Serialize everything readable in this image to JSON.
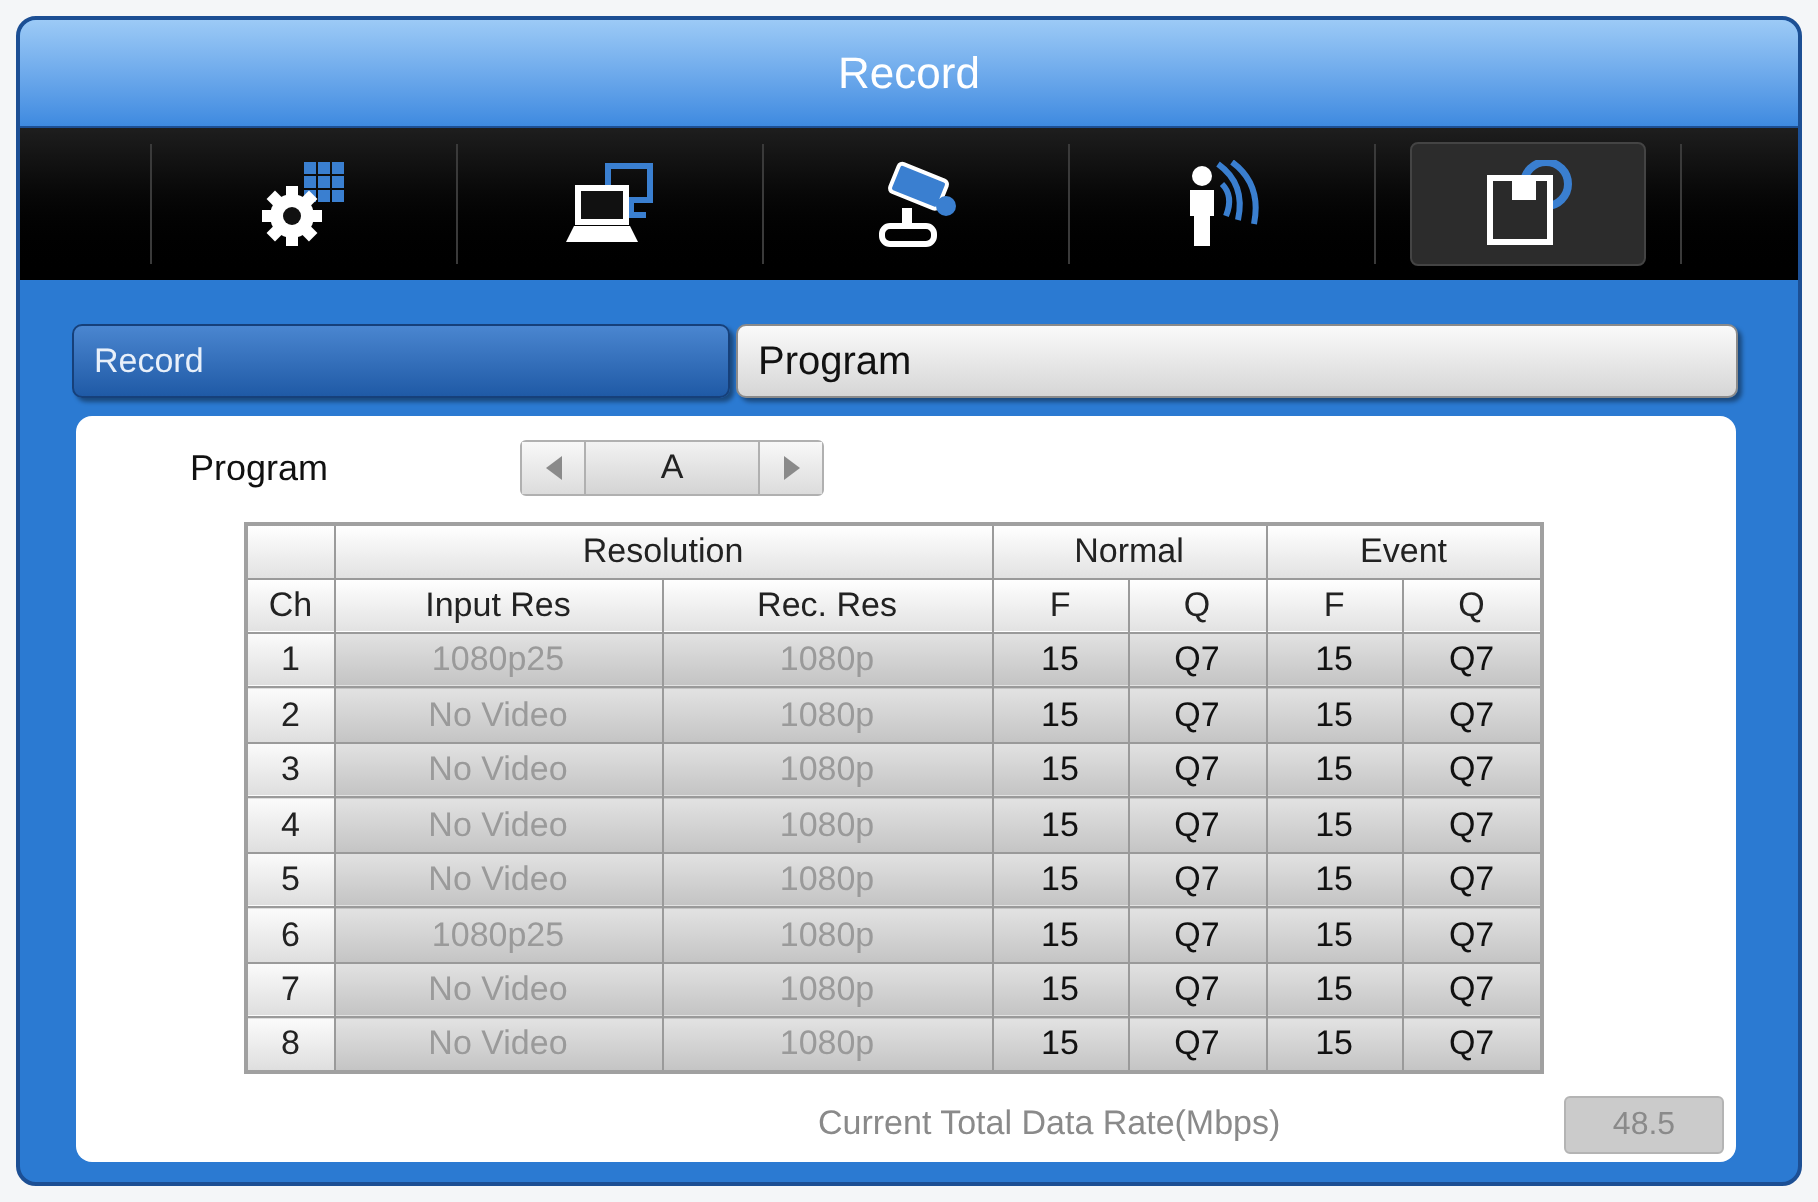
{
  "window": {
    "title": "Record"
  },
  "toolbar": [
    {
      "kind": "setup",
      "selected": false
    },
    {
      "kind": "network",
      "selected": false
    },
    {
      "kind": "camera",
      "selected": false
    },
    {
      "kind": "event",
      "selected": false
    },
    {
      "kind": "record",
      "selected": true
    }
  ],
  "tabs": [
    {
      "label": "Record",
      "selected": true
    },
    {
      "label": "Program",
      "selected": false
    }
  ],
  "program": {
    "label": "Program",
    "value": "A"
  },
  "table": {
    "first_column": "Ch",
    "column_groups": [
      {
        "label": "Resolution",
        "disabled": true,
        "columns": [
          "Input Res",
          "Rec. Res"
        ]
      },
      {
        "label": "Normal",
        "disabled": false,
        "columns": [
          "F",
          "Q"
        ]
      },
      {
        "label": "Event",
        "disabled": false,
        "columns": [
          "F",
          "Q"
        ]
      }
    ],
    "rows": [
      {
        "ch": "1",
        "cells": [
          "1080p25",
          "1080p",
          "15",
          "Q7",
          "15",
          "Q7"
        ]
      },
      {
        "ch": "2",
        "cells": [
          "No Video",
          "1080p",
          "15",
          "Q7",
          "15",
          "Q7"
        ]
      },
      {
        "ch": "3",
        "cells": [
          "No Video",
          "1080p",
          "15",
          "Q7",
          "15",
          "Q7"
        ]
      },
      {
        "ch": "4",
        "cells": [
          "No Video",
          "1080p",
          "15",
          "Q7",
          "15",
          "Q7"
        ]
      },
      {
        "ch": "5",
        "cells": [
          "No Video",
          "1080p",
          "15",
          "Q7",
          "15",
          "Q7"
        ]
      },
      {
        "ch": "6",
        "cells": [
          "1080p25",
          "1080p",
          "15",
          "Q7",
          "15",
          "Q7"
        ]
      },
      {
        "ch": "7",
        "cells": [
          "No Video",
          "1080p",
          "15",
          "Q7",
          "15",
          "Q7"
        ]
      },
      {
        "ch": "8",
        "cells": [
          "No Video",
          "1080p",
          "15",
          "Q7",
          "15",
          "Q7"
        ]
      }
    ]
  },
  "data_rate": {
    "label": "Current Total Data Rate(Mbps)",
    "value": "48.5",
    "disabled": true
  }
}
